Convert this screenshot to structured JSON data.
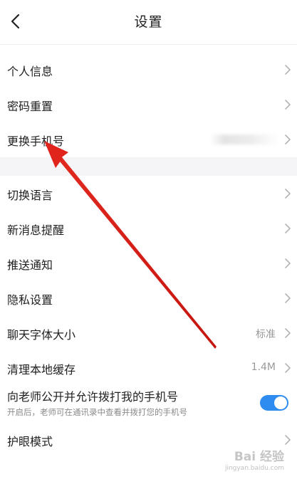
{
  "header": {
    "title": "设置",
    "back_icon": "chevron-left-icon"
  },
  "group1": [
    {
      "label": "个人信息"
    },
    {
      "label": "密码重置"
    },
    {
      "label": "更换手机号",
      "value_obscured": true
    }
  ],
  "group2": [
    {
      "label": "切换语言"
    },
    {
      "label": "新消息提醒"
    },
    {
      "label": "推送通知"
    },
    {
      "label": "隐私设置"
    },
    {
      "label": "聊天字体大小",
      "value": "标准"
    },
    {
      "label": "清理本地缓存",
      "value": "1.4M"
    }
  ],
  "phone_visibility": {
    "label": "向老师公开并允许拨打我的手机号",
    "description": "开启后，老师可在通讯录中查看并拨打您的手机号",
    "enabled": true
  },
  "eye_care": {
    "label": "护眼模式"
  },
  "watermark": {
    "brand": "Bai 经验",
    "url": "jingyan.baidu.com"
  },
  "colors": {
    "toggle_on": "#2e8cf0",
    "annotation_arrow": "#e0241c",
    "section_gap": "#f5f5f7"
  }
}
